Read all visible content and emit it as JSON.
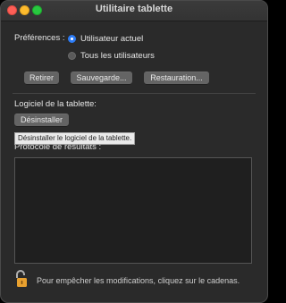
{
  "window": {
    "title": "Utilitaire tablette"
  },
  "preferences": {
    "label": "Préférences :",
    "options": [
      {
        "label": "Utilisateur actuel",
        "selected": true
      },
      {
        "label": "Tous les utilisateurs",
        "selected": false
      }
    ]
  },
  "actions": {
    "remove_label": "Retirer",
    "backup_label": "Sauvegarde...",
    "restore_label": "Restauration..."
  },
  "software": {
    "label": "Logiciel de la tablette:",
    "uninstall_label": "Désinstaller",
    "tooltip": "Désinstaller le logiciel de la tablette."
  },
  "log": {
    "label": "Protocole de resultats :",
    "content": ""
  },
  "footer": {
    "lock_icon": "open-padlock-icon",
    "text": "Pour empêcher les modifications, cliquez sur le cadenas."
  },
  "colors": {
    "window_bg": "#2a2a2a",
    "button_bg": "#646464",
    "radio_accent": "#2d7cf6",
    "lock_color": "#e9a12f"
  }
}
